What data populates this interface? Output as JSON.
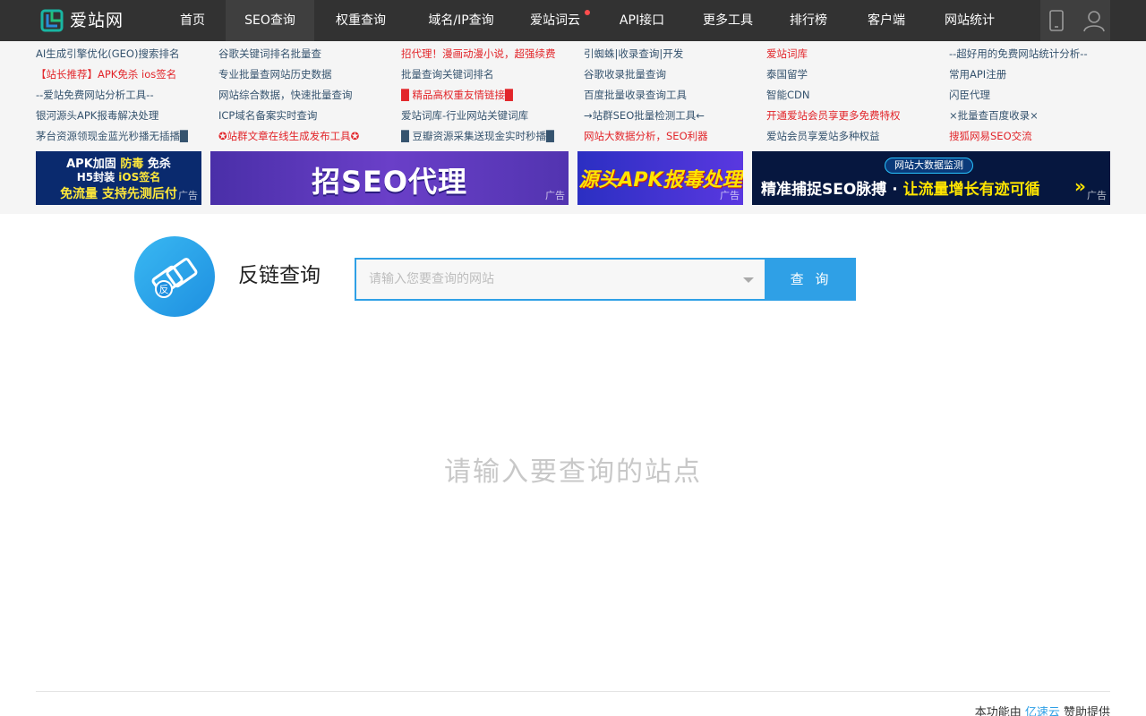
{
  "header": {
    "logo_text": "爱站网",
    "nav": [
      {
        "label": "首页"
      },
      {
        "label": "SEO查询"
      },
      {
        "label": "权重查询"
      },
      {
        "label": "域名/IP查询"
      },
      {
        "label": "爱站词云"
      },
      {
        "label": "API接口"
      },
      {
        "label": "更多工具"
      },
      {
        "label": "排行榜"
      },
      {
        "label": "客户端"
      },
      {
        "label": "网站统计"
      }
    ],
    "active_nav": "SEO查询",
    "icons": [
      "mobile-icon",
      "user-icon"
    ]
  },
  "link_grid": [
    [
      "AI生成引擎优化(GEO)搜索排名",
      "谷歌关键词排名批量查",
      "招代理！漫画动漫小说，超强续费",
      "引蜘蛛|收录查询|开发",
      "爱站词库",
      "--超好用的免费网站统计分析--"
    ],
    [
      "【站长推荐】APK免杀 ios签名",
      "专业批量查网站历史数据",
      "批量查询关键词排名",
      "谷歌收录批量查询",
      "泰国留学",
      "常用API注册"
    ],
    [
      "--爱站免费网站分析工具--",
      "网站综合数据，快速批量查询",
      "█ 精品高权重友情链接█",
      "百度批量收录查询工具",
      "智能CDN",
      "闪臣代理"
    ],
    [
      "银河源头APK报毒解决处理",
      "ICP域名备案实时查询",
      "爱站词库-行业网站关键词库",
      "→站群SEO批量检测工具←",
      "开通爱站会员享更多免费特权",
      "×批量查百度收录×"
    ],
    [
      "茅台资源领现金蓝光秒播无插播█",
      "✪站群文章在线生成发布工具✪",
      "█ 豆瓣资源采集送现金实时秒播█",
      "网站大数据分析，SEO利器",
      "爱站会员享爱站多种权益",
      "搜狐网易SEO交流"
    ]
  ],
  "link_colors": [
    [
      "blue",
      "blue",
      "red",
      "blue",
      "red",
      "blue"
    ],
    [
      "red",
      "blue",
      "blue",
      "blue",
      "blue",
      "blue"
    ],
    [
      "blue",
      "blue",
      "red",
      "blue",
      "blue",
      "blue"
    ],
    [
      "blue",
      "blue",
      "blue",
      "blue",
      "red",
      "blue"
    ],
    [
      "blue",
      "red",
      "blue",
      "red",
      "blue",
      "red"
    ]
  ],
  "banners": {
    "ad_label": "广告",
    "b1": {
      "line1_a": "APK加固 ",
      "line1_b": "防毒 ",
      "line1_c": "免杀",
      "line2_a": "H5封装 ",
      "line2_b": "iOS签名",
      "line3": "免流量 支持先测后付"
    },
    "b2": {
      "text": "招SEO代理"
    },
    "b3": {
      "text": "源头APK报毒处理"
    },
    "b4": {
      "pill": "网站大数据监测",
      "text_a": "精准捕捉SEO脉搏 · ",
      "text_b": "让流量增长有迹可循",
      "arrows": "»"
    }
  },
  "tool": {
    "icon_char": "反",
    "title": "反链查询",
    "search_placeholder": "请输入您要查询的网站",
    "search_button": "查 询",
    "empty_hint": "请输入要查询的站点"
  },
  "footer": {
    "prefix": "本功能由 ",
    "sponsor": "亿速云",
    "suffix": " 赞助提供"
  },
  "colors": {
    "nav_bg": "#323232",
    "accent": "#2fa0e6",
    "link_blue": "#35536e",
    "link_red": "#e2252a"
  }
}
